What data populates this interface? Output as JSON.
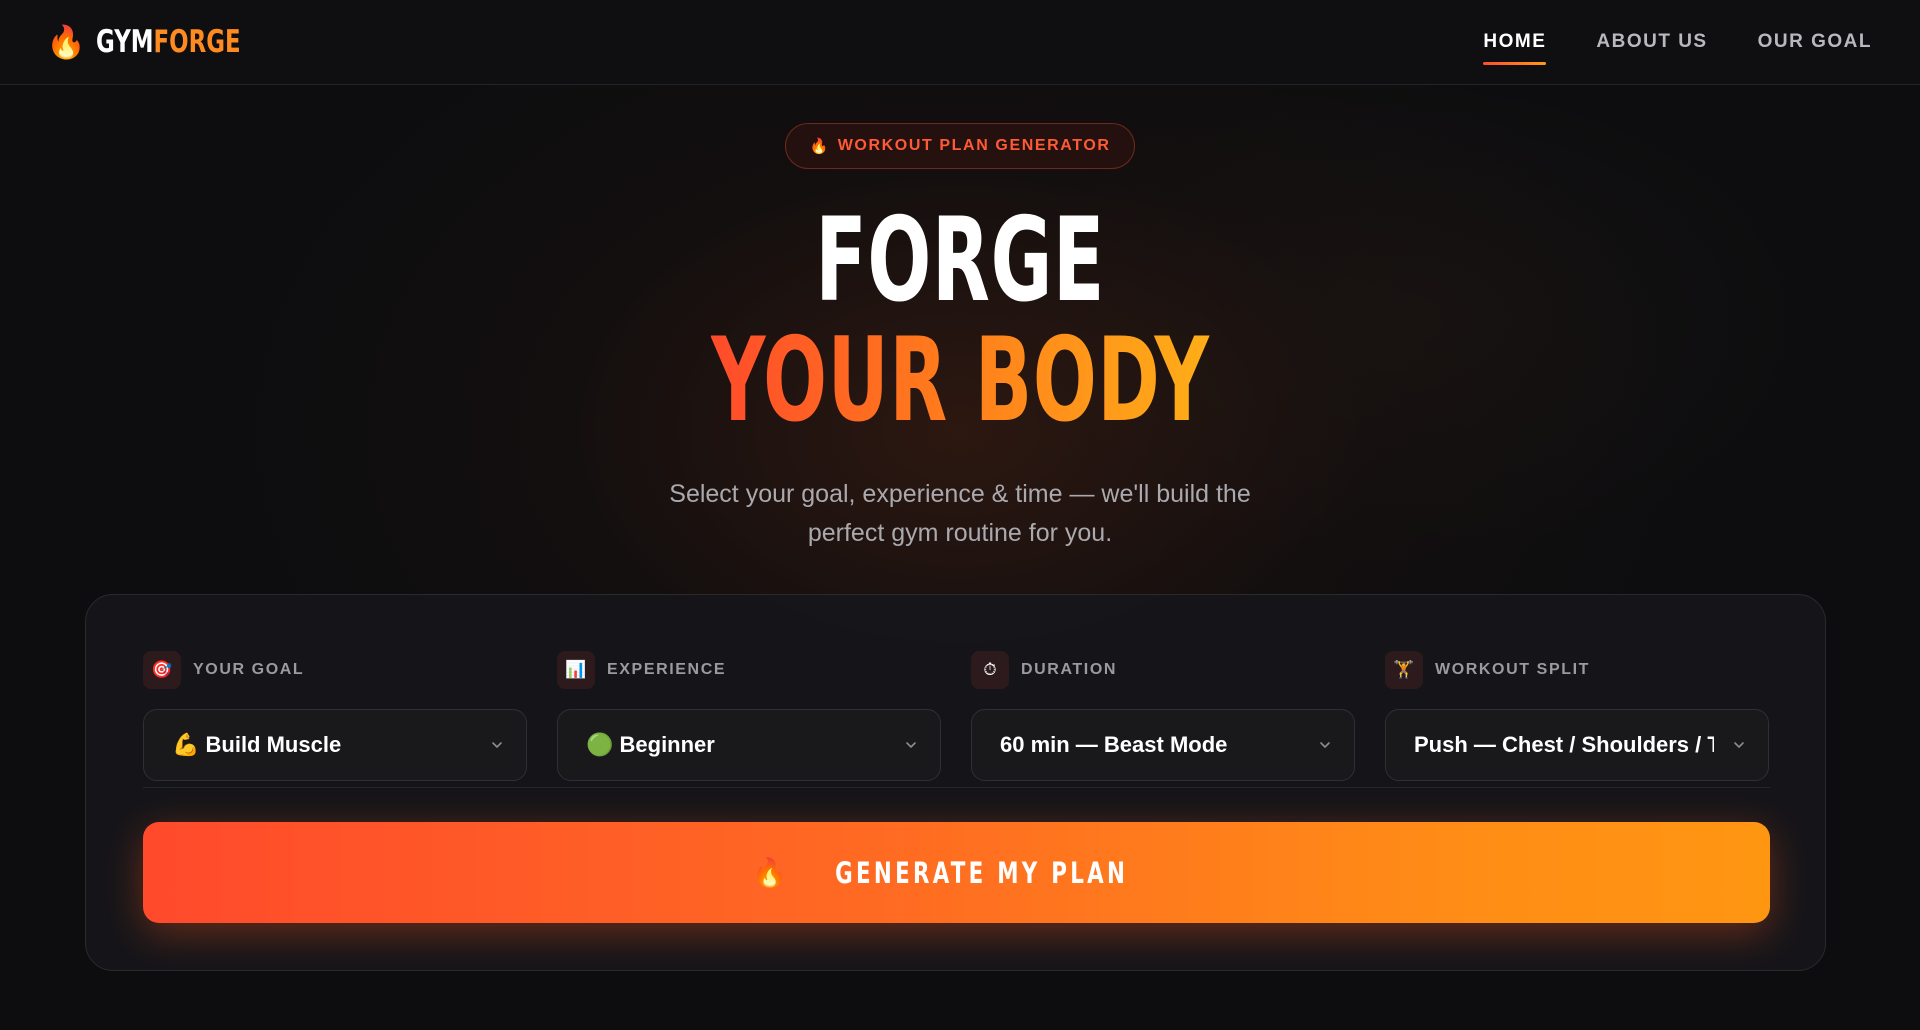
{
  "nav": {
    "logo_icon": "🔥",
    "logo_part1": "GYM",
    "logo_part2": "FORGE",
    "links": [
      {
        "label": "HOME",
        "active": true
      },
      {
        "label": "ABOUT US",
        "active": false
      },
      {
        "label": "OUR GOAL",
        "active": false
      }
    ]
  },
  "hero": {
    "badge_icon": "🔥",
    "badge_text": "WORKOUT PLAN GENERATOR",
    "title_line1": "FORGE",
    "title_line2": "YOUR BODY",
    "subtitle": "Select your goal, experience & time — we'll build the perfect gym routine for you."
  },
  "form": {
    "fields": [
      {
        "icon": "🎯",
        "icon_name": "target-icon",
        "label": "YOUR GOAL",
        "value": "💪 Build Muscle"
      },
      {
        "icon": "📊",
        "icon_name": "chart-icon",
        "label": "EXPERIENCE",
        "value": "🟢 Beginner"
      },
      {
        "icon": "⏱",
        "icon_name": "stopwatch-icon",
        "label": "DURATION",
        "value": "60 min — Beast Mode"
      },
      {
        "icon": "🏋",
        "icon_name": "weightlifter-icon",
        "label": "WORKOUT SPLIT",
        "value": "Push — Chest / Shoulders / Triceps"
      }
    ],
    "generate_icon": "🔥",
    "generate_label": "GENERATE MY PLAN"
  },
  "colors": {
    "accent_start": "#ff4b2b",
    "accent_end": "#ffae18",
    "background": "#0d0d0f"
  }
}
